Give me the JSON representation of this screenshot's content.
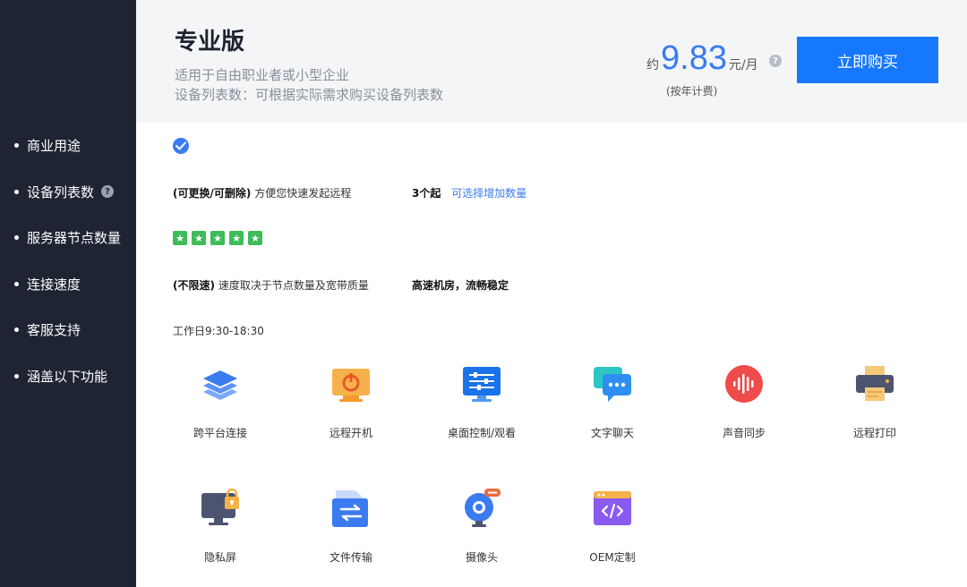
{
  "sidebar": {
    "items": [
      {
        "label": "商业用途"
      },
      {
        "label": "设备列表数",
        "help": "?"
      },
      {
        "label": "服务器节点数量"
      },
      {
        "label": "连接速度"
      },
      {
        "label": "客服支持"
      },
      {
        "label": "涵盖以下功能"
      }
    ]
  },
  "header": {
    "title": "专业版",
    "desc1": "适用于自由职业者或小型企业",
    "desc2": "设备列表数：可根据实际需求购买设备列表数",
    "price_prefix": "约",
    "price_amount": "9.83",
    "price_unit": "元/月",
    "price_note": "(按年计费)",
    "price_help": "?",
    "buy_label": "立即购买"
  },
  "rows": {
    "devices_bold": "(可更换/可删除)",
    "devices_text": "方便您快速发起远程",
    "devices_count": "3个起",
    "devices_link": "可选择增加数量",
    "server_rating": 5,
    "speed_bold": "(不限速)",
    "speed_text": "速度取决于节点数量及宽带质量",
    "speed_note": "高速机房，流畅稳定",
    "support": "工作日9:30-18:30"
  },
  "features": [
    {
      "label": "跨平台连接",
      "icon": "layers-icon"
    },
    {
      "label": "远程开机",
      "icon": "power-icon"
    },
    {
      "label": "桌面控制/观看",
      "icon": "desktop-control-icon"
    },
    {
      "label": "文字聊天",
      "icon": "chat-icon"
    },
    {
      "label": "声音同步",
      "icon": "sound-wave-icon"
    },
    {
      "label": "远程打印",
      "icon": "printer-icon"
    },
    {
      "label": "隐私屏",
      "icon": "privacy-screen-icon"
    },
    {
      "label": "文件传输",
      "icon": "file-transfer-icon"
    },
    {
      "label": "摄像头",
      "icon": "camera-icon"
    },
    {
      "label": "OEM定制",
      "icon": "code-window-icon"
    }
  ],
  "colors": {
    "sidebar_bg": "#1f2433",
    "accent": "#1677ff",
    "price": "#3a7bf0",
    "star": "#3dbc58"
  }
}
